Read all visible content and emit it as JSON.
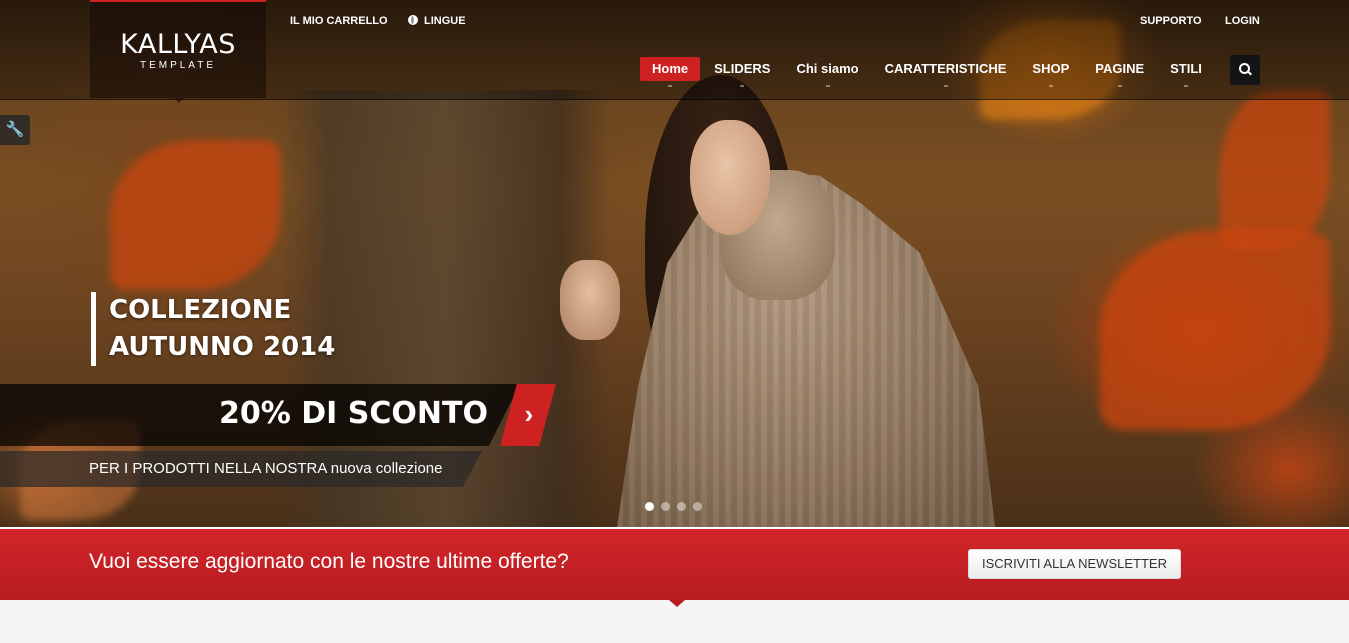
{
  "header": {
    "logo_main": "KALLYAS",
    "logo_sub": "TEMPLATE",
    "top_left_links": [
      {
        "label": "IL MIO CARRELLO"
      },
      {
        "label": "LINGUE",
        "icon": "globe-icon"
      }
    ],
    "top_right_links": [
      {
        "label": "SUPPORTO"
      },
      {
        "label": "LOGIN"
      }
    ],
    "nav": [
      {
        "label": "Home",
        "active": true
      },
      {
        "label": "SLIDERS"
      },
      {
        "label": "Chi siamo"
      },
      {
        "label": "CARATTERISTICHE"
      },
      {
        "label": "SHOP"
      },
      {
        "label": "PAGINE"
      },
      {
        "label": "STILI"
      }
    ],
    "search_icon": "search-icon"
  },
  "tool_icon": "wrench-icon",
  "slider": {
    "title_line1": "COLLEZIONE",
    "title_line2": "AUTUNNO 2014",
    "discount": "20% DI SCONTO",
    "arrow": "›",
    "subtitle": "PER I PRODOTTI NELLA NOSTRA nuova collezione",
    "dots": 4,
    "active_dot": 1
  },
  "newsletter": {
    "text": "Vuoi essere aggiornato con le nostre ultime offerte?",
    "button": "ISCRIVITI ALLA NEWSLETTER"
  },
  "colors": {
    "accent": "#cd2122",
    "bar": "#c21f23"
  }
}
